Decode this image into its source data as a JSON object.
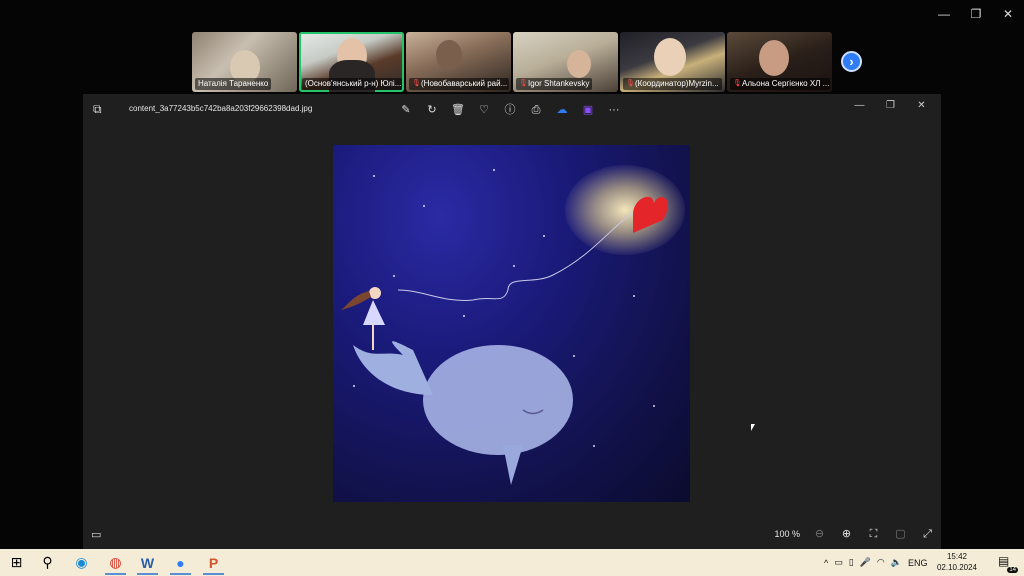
{
  "meeting": {
    "participants": [
      {
        "name": "Наталія Тараненко",
        "muted": false
      },
      {
        "name": "(Основ'янський р-н) Юлі...",
        "muted": false
      },
      {
        "name": "(Новобаварський рай...",
        "muted": true
      },
      {
        "name": "Igor Shtankevsky",
        "muted": true
      },
      {
        "name": "(Координатор)Myrzin...",
        "muted": true
      },
      {
        "name": "Альона Сергієнко ХЛ ...",
        "muted": true
      }
    ],
    "active_speaker_index": 1
  },
  "viewer": {
    "file_name": "content_3a77243b5c742ba8a203f29662398dad.jpg",
    "zoom": "100 %",
    "toolbar": [
      "edit-icon",
      "rotate-icon",
      "delete-icon",
      "favorite-icon",
      "info-icon",
      "print-icon",
      "onedrive-icon",
      "clipchamp-icon",
      "more-icon"
    ],
    "accent": "#2f7cf6"
  },
  "taskbar": {
    "apps": [
      "windows-start-icon",
      "search-icon",
      "edge-icon",
      "chrome-icon",
      "word-icon",
      "zoom-icon",
      "powerpoint-icon"
    ],
    "language": "ENG",
    "time": "15:42",
    "date": "02.10.2024",
    "notifications": "14"
  }
}
